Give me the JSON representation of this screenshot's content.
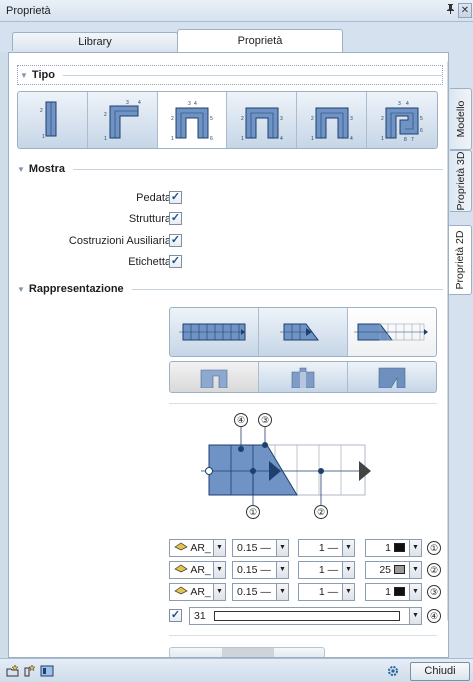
{
  "window": {
    "title": "Proprietà",
    "pin": "ᵖ",
    "close": "✕"
  },
  "tabs": [
    {
      "label": "Library"
    },
    {
      "label": "Proprietà"
    }
  ],
  "side_tabs": [
    {
      "label": "Modello"
    },
    {
      "label": "Proprietà 3D"
    },
    {
      "label": "Proprietà 2D"
    }
  ],
  "sections": {
    "tipo": {
      "title": "Tipo",
      "chev": "▼"
    },
    "mostra": {
      "title": "Mostra",
      "chev": "▼"
    },
    "rappresentazione": {
      "title": "Rappresentazione",
      "chev": "▼"
    }
  },
  "tipo_options": [
    {
      "name": "straight",
      "selected": false
    },
    {
      "name": "l-shape",
      "selected": false
    },
    {
      "name": "u-shape-a",
      "selected": true
    },
    {
      "name": "u-shape-b",
      "selected": false
    },
    {
      "name": "u-shape-c",
      "selected": false
    },
    {
      "name": "spiral",
      "selected": false
    }
  ],
  "mostra": [
    {
      "label": "Pedata",
      "checked": true
    },
    {
      "label": "Struttura",
      "checked": true
    },
    {
      "label": "Costruzioni Ausiliaria",
      "checked": true
    },
    {
      "label": "Etichetta",
      "checked": true
    }
  ],
  "check_mark": "✓",
  "diagram_labels": {
    "c1": "①",
    "c2": "②",
    "c3": "③",
    "c4": "④"
  },
  "rows": [
    {
      "layer": "AR_",
      "thickness": "0.15 —",
      "line": "1 —",
      "color": "1",
      "swatch": "#111111",
      "num": "①"
    },
    {
      "layer": "AR_",
      "thickness": "0.15 —",
      "line": "1 —",
      "color": "25",
      "swatch": "#9a9a9a",
      "num": "②"
    },
    {
      "layer": "AR_",
      "thickness": "0.15 —",
      "line": "1 —",
      "color": "1",
      "swatch": "#111111",
      "num": "③"
    }
  ],
  "fill_row": {
    "checked": true,
    "value": "31",
    "num": "④"
  },
  "dropdown_arrow": "▼",
  "bottom": {
    "close_label": "Chiudi"
  }
}
